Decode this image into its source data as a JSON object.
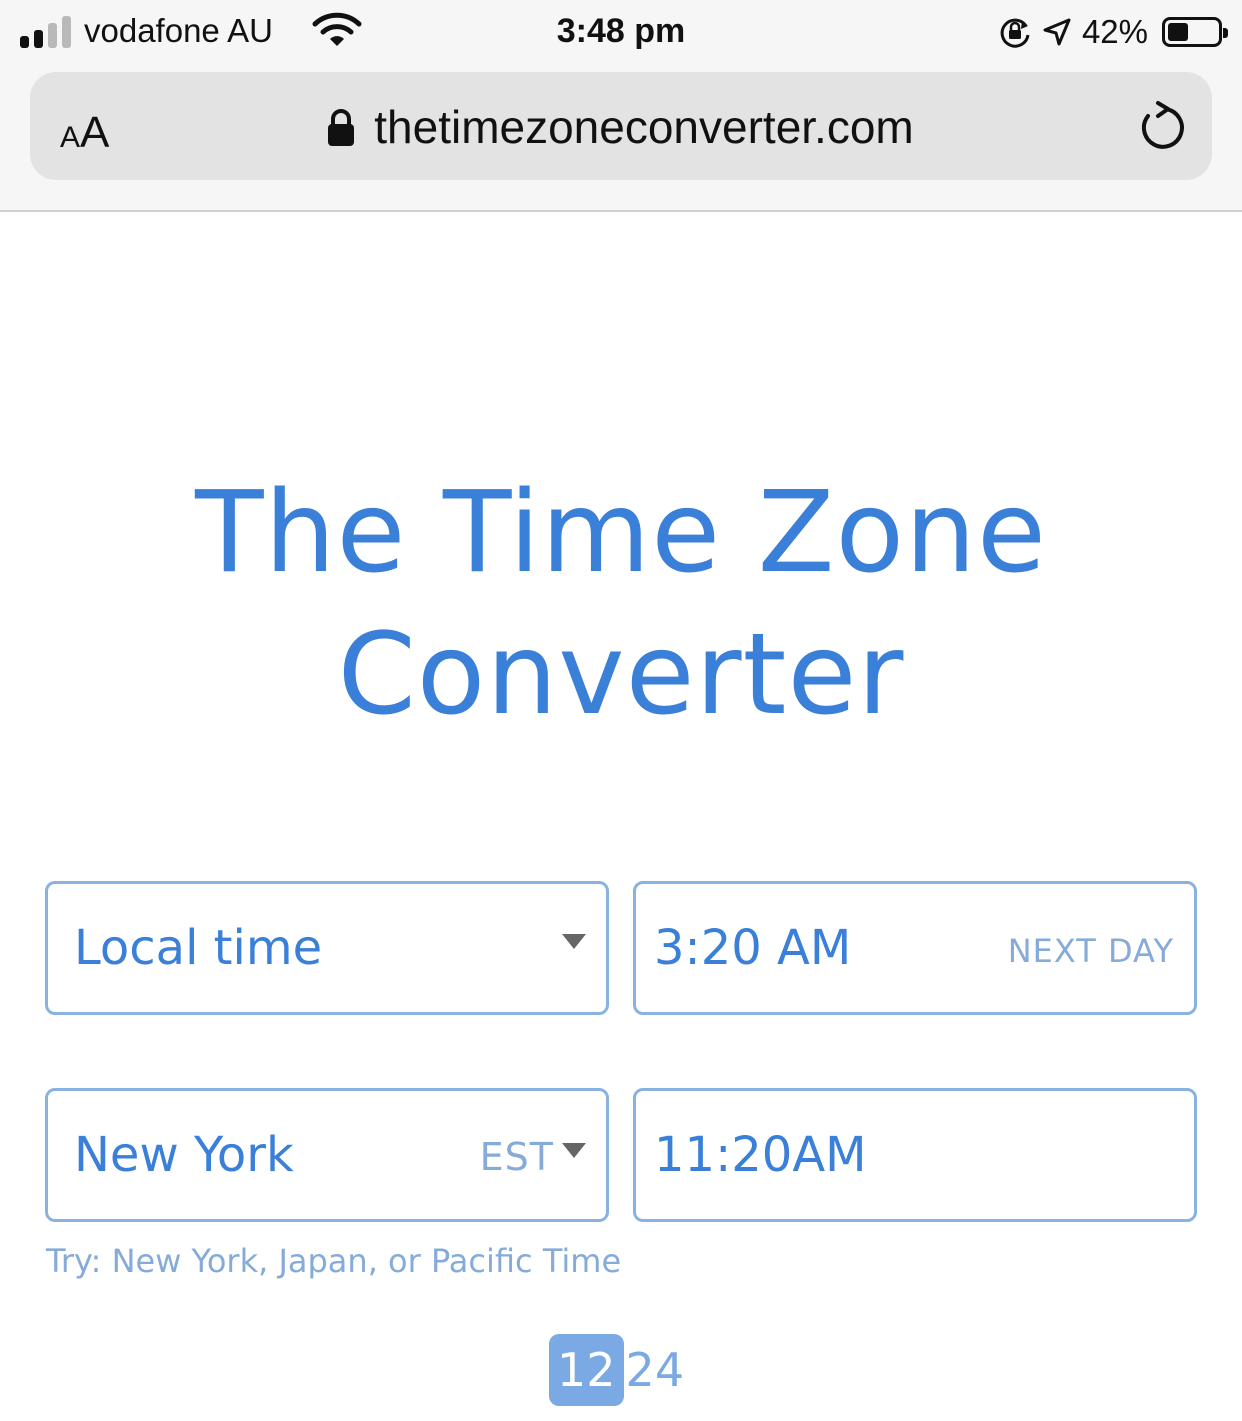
{
  "status_bar": {
    "carrier": "vodafone AU",
    "time": "3:48 pm",
    "battery_percent": "42%",
    "battery_level": 0.42,
    "icons": [
      "signal-icon",
      "wifi-icon",
      "orientation-lock-icon",
      "location-arrow-icon",
      "battery-icon"
    ]
  },
  "browser": {
    "text_size_small": "A",
    "text_size_large": "A",
    "url": "thetimezoneconverter.com",
    "icons": [
      "lock-icon",
      "reload-icon"
    ]
  },
  "page": {
    "title_line1": "The Time Zone",
    "title_line2": "Converter",
    "row1": {
      "zone_label": "Local time",
      "time_value": "3:20 AM",
      "day_note": "NEXT DAY"
    },
    "row2": {
      "zone_label": "New York",
      "zone_abbr": "EST",
      "time_value": "11:20AM"
    },
    "hint": "Try: New York, Japan, or Pacific Time",
    "format_toggle": {
      "option_12": "12",
      "option_24": "24",
      "selected": "12"
    }
  },
  "colors": {
    "accent": "#3a7fd8",
    "muted_accent": "#86abd9",
    "field_border": "#8ab2e0",
    "toggle_active": "#7aa9e3"
  }
}
